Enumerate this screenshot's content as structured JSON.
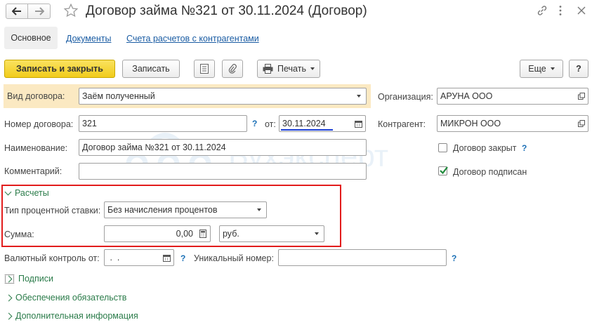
{
  "window": {
    "title": "Договор займа №321 от 30.11.2024 (Договор)"
  },
  "tabs": [
    {
      "label": "Основное",
      "active": true
    },
    {
      "label": "Документы"
    },
    {
      "label": "Счета расчетов с контрагентами"
    }
  ],
  "toolbar": {
    "save_close_label": "Записать и закрыть",
    "save_label": "Записать",
    "print_label": "Печать",
    "more_label": "Еще",
    "help_label": "?"
  },
  "form": {
    "contract_type_label": "Вид договора:",
    "contract_type_value": "Заём полученный",
    "organization_label": "Организация:",
    "organization_value": "АРУНА ООО",
    "number_label": "Номер договора:",
    "number_value": "321",
    "date_from_label": "от:",
    "date_value": "30.11.2024",
    "counterparty_label": "Контрагент:",
    "counterparty_value": "МИКРОН ООО",
    "name_label": "Наименование:",
    "name_value": "Договор займа №321 от 30.11.2024",
    "closed_label": "Договор закрыт",
    "closed_checked": false,
    "comment_label": "Комментарий:",
    "comment_value": "",
    "signed_label": "Договор подписан",
    "signed_checked": true,
    "help_mark": "?"
  },
  "settlements": {
    "header": "Расчеты",
    "rate_type_label": "Тип процентной ставки:",
    "rate_type_value": "Без начисления процентов",
    "amount_label": "Сумма:",
    "amount_value": "0,00",
    "currency_value": "руб."
  },
  "currency_control": {
    "label": "Валютный контроль от:",
    "date_value": " .  .",
    "unique_number_label": "Уникальный номер:",
    "unique_number_value": ""
  },
  "sections": [
    {
      "label": "Подписи"
    },
    {
      "label": "Обеспечения обязательств"
    },
    {
      "label": "Дополнительная информация"
    }
  ],
  "watermark": {
    "text": "Бухэксперт"
  },
  "colors": {
    "accent_yellow": "#f5d328",
    "link_blue": "#1a5ca3",
    "section_green": "#2a7b49",
    "highlight_red": "#e21c1c",
    "help_blue": "#1a6fb6"
  },
  "icons": [
    "back-arrow-icon",
    "forward-arrow-icon",
    "star-icon",
    "link-icon",
    "kebab-menu-icon",
    "close-icon",
    "list-icon",
    "paperclip-icon",
    "printer-icon",
    "calendar-icon",
    "calculator-icon",
    "open-icon",
    "checkbox-icon"
  ]
}
